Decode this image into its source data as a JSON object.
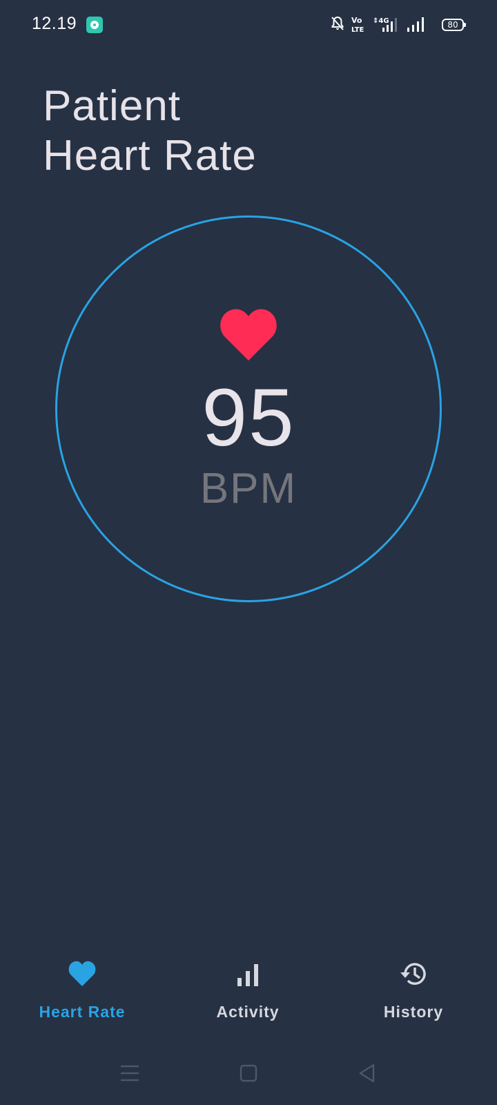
{
  "status_bar": {
    "time": "12.19",
    "battery_level": "80",
    "icons": [
      "app-notification-icon",
      "bell-off-icon",
      "volte-icon",
      "signal-4g-icon",
      "signal-icon",
      "battery-icon"
    ]
  },
  "title": {
    "line1": "Patient",
    "line2": "Heart Rate"
  },
  "heart_rate": {
    "value": "95",
    "unit": "BPM",
    "icon": "heart-icon"
  },
  "bottom_nav": {
    "items": [
      {
        "label": "Heart Rate",
        "icon": "heart-icon",
        "active": true
      },
      {
        "label": "Activity",
        "icon": "bar-chart-icon",
        "active": false
      },
      {
        "label": "History",
        "icon": "history-icon",
        "active": false
      }
    ]
  },
  "system_nav": {
    "icons": [
      "menu-icon",
      "home-icon",
      "back-icon"
    ]
  },
  "colors": {
    "background": "#263144",
    "accent": "#2aa3e3",
    "heart": "#ff2d55",
    "text": "#e6e2e8",
    "muted": "#75767c"
  }
}
